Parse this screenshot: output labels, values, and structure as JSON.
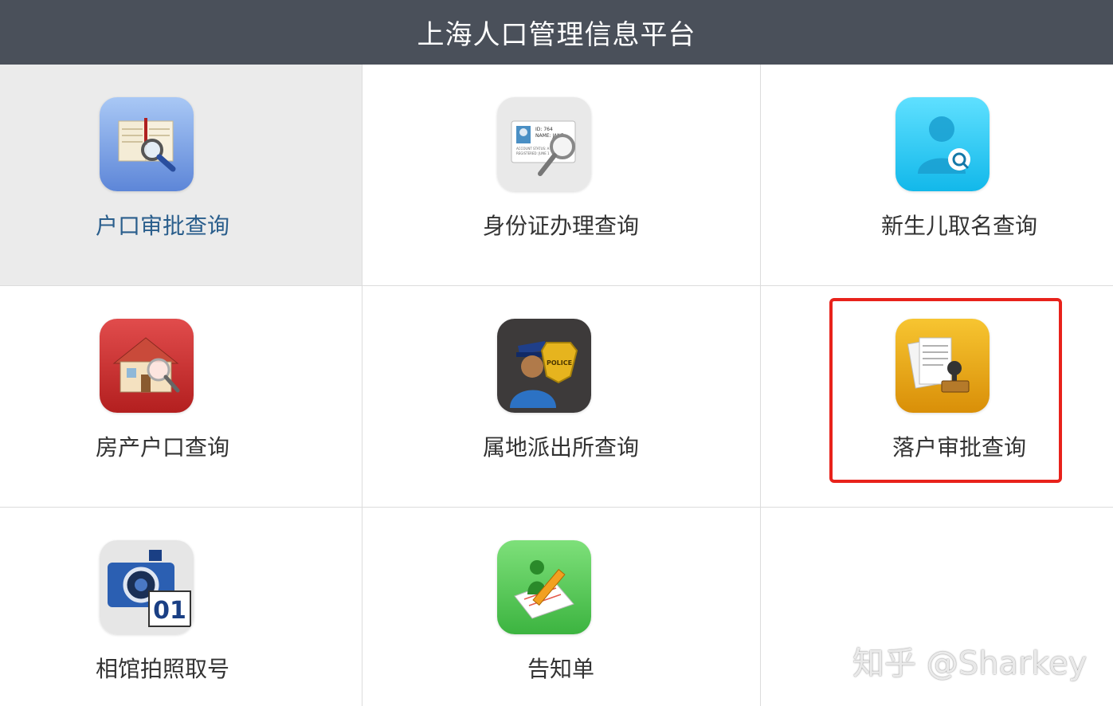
{
  "header": {
    "title": "上海人口管理信息平台"
  },
  "tiles": [
    {
      "label": "户口审批查询",
      "icon": "book-search-icon",
      "selected": true
    },
    {
      "label": "身份证办理查询",
      "icon": "id-card-search-icon",
      "selected": false
    },
    {
      "label": "新生儿取名查询",
      "icon": "person-search-icon",
      "selected": false
    },
    {
      "label": "房产户口查询",
      "icon": "house-search-icon",
      "selected": false
    },
    {
      "label": "属地派出所查询",
      "icon": "police-icon",
      "selected": false
    },
    {
      "label": "落户审批查询",
      "icon": "document-stamp-icon",
      "selected": false,
      "highlighted": true
    },
    {
      "label": "相馆拍照取号",
      "icon": "camera-number-icon",
      "selected": false
    },
    {
      "label": "告知单",
      "icon": "notice-edit-icon",
      "selected": false
    }
  ],
  "camera_badge": "01",
  "police_badge": "POLICE",
  "id_card_text": {
    "id": "ID: 764",
    "name": "NAME: JANE",
    "line1": "ACCOUNT STATUS: A",
    "line2": "REGISTERED: JUNE 1"
  },
  "watermark": "知乎 @Sharkey",
  "colors": {
    "header_bg": "#4a505a",
    "highlight": "#e8221b",
    "selected_bg": "#ebebeb",
    "active_label": "#2a5e8c"
  }
}
